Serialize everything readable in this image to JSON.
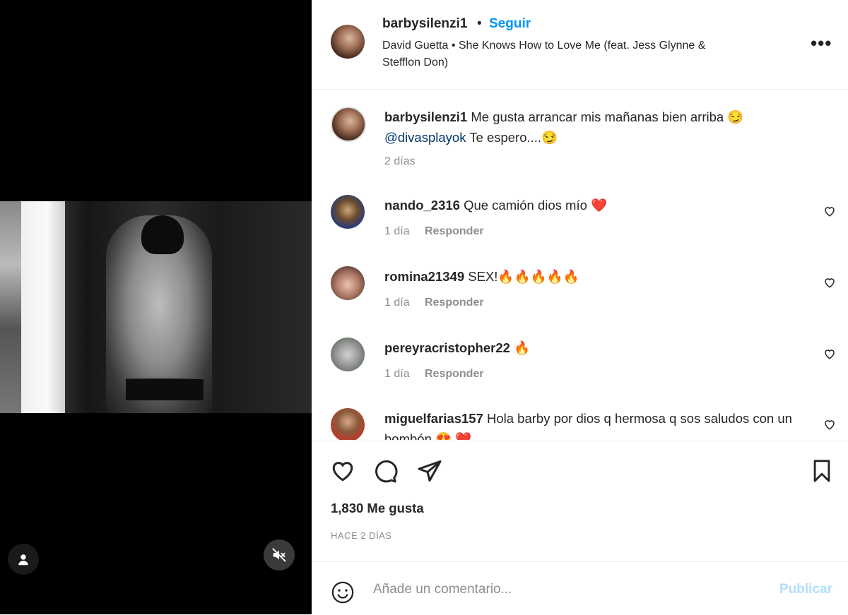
{
  "post": {
    "username": "barbysilenzi1",
    "separator": "•",
    "follow_label": "Seguir",
    "music": "David Guetta • She Knows How to Love Me (feat. Jess Glynne & Stefflon Don)",
    "more_label": "•••"
  },
  "caption": {
    "username": "barbysilenzi1",
    "text": " Me gusta arrancar mis mañanas bien arriba 😏",
    "mention": "@divasplayok",
    "text2": " Te espero....😏",
    "time": "2 días"
  },
  "comments": [
    {
      "username": "nando_2316",
      "text": " Que camión dios mío ❤️",
      "time": "1 día",
      "reply": "Responder"
    },
    {
      "username": "romina21349",
      "text": " SEX!🔥🔥🔥🔥🔥",
      "time": "1 día",
      "reply": "Responder"
    },
    {
      "username": "pereyracristopher22",
      "text": " 🔥",
      "time": "1 día",
      "reply": "Responder"
    },
    {
      "username": "miguelfarias157",
      "text": " Hola barby por dios q hermosa q sos saludos con un bombón 😍 ❤️",
      "time": "",
      "reply": ""
    }
  ],
  "stats": {
    "likes": "1,830 Me gusta",
    "date": "HACE 2 DÍAS"
  },
  "comment_box": {
    "placeholder": "Añade un comentario...",
    "publish_label": "Publicar"
  },
  "colors": {
    "accent": "#0095f6",
    "publish_disabled": "#b2dffc",
    "secondary_text": "#8e8e8e",
    "mention": "#00376b"
  },
  "icons": {
    "more": "more-options-icon",
    "like": "heart-icon",
    "comment": "comment-icon",
    "share": "share-icon",
    "save": "bookmark-icon",
    "emoji": "emoji-icon",
    "user_tags": "user-icon",
    "mute": "muted-speaker-icon"
  }
}
